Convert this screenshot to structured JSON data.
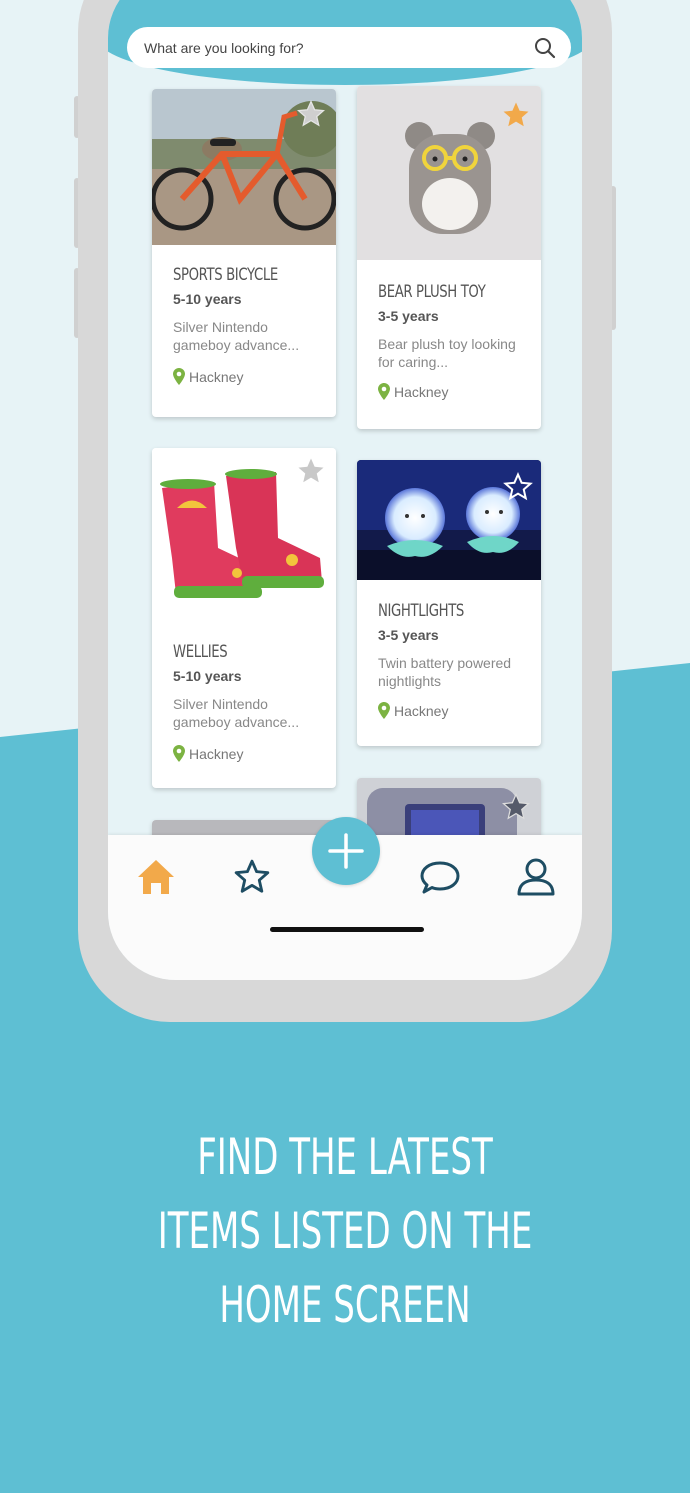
{
  "search": {
    "placeholder": "What are you looking for?"
  },
  "products": [
    {
      "title": "SPORTS BICYCLE",
      "age": "5-10 years",
      "desc": "Silver Nintendo gameboy advance...",
      "location": "Hackney",
      "favorited": false,
      "image": "bicycle"
    },
    {
      "title": "BEAR PLUSH TOY",
      "age": "3-5 years",
      "desc": "Bear plush toy looking for caring...",
      "location": "Hackney",
      "favorited": true,
      "image": "bear"
    },
    {
      "title": "WELLIES",
      "age": "5-10 years",
      "desc": "Silver Nintendo gameboy advance...",
      "location": "Hackney",
      "favorited": false,
      "image": "wellies"
    },
    {
      "title": "NIGHTLIGHTS",
      "age": "3-5 years",
      "desc": "Twin battery powered nightlights",
      "location": "Hackney",
      "favorited": false,
      "image": "nightlights"
    },
    {
      "image": "gameboy",
      "favorited": false
    }
  ],
  "nav": {
    "items": [
      "home-icon",
      "star-icon",
      "plus-icon",
      "chat-icon",
      "profile-icon"
    ],
    "active": "home"
  },
  "caption": [
    "FIND THE LATEST",
    "ITEMS LISTED ON THE",
    "HOME SCREEN"
  ],
  "colors": {
    "brand": "#5ebfd3",
    "background": "#e7f3f6",
    "star_active": "#f2a94a",
    "home_active": "#f2a94a",
    "nav_icon": "#1e4d63",
    "pin": "#7cb342"
  }
}
